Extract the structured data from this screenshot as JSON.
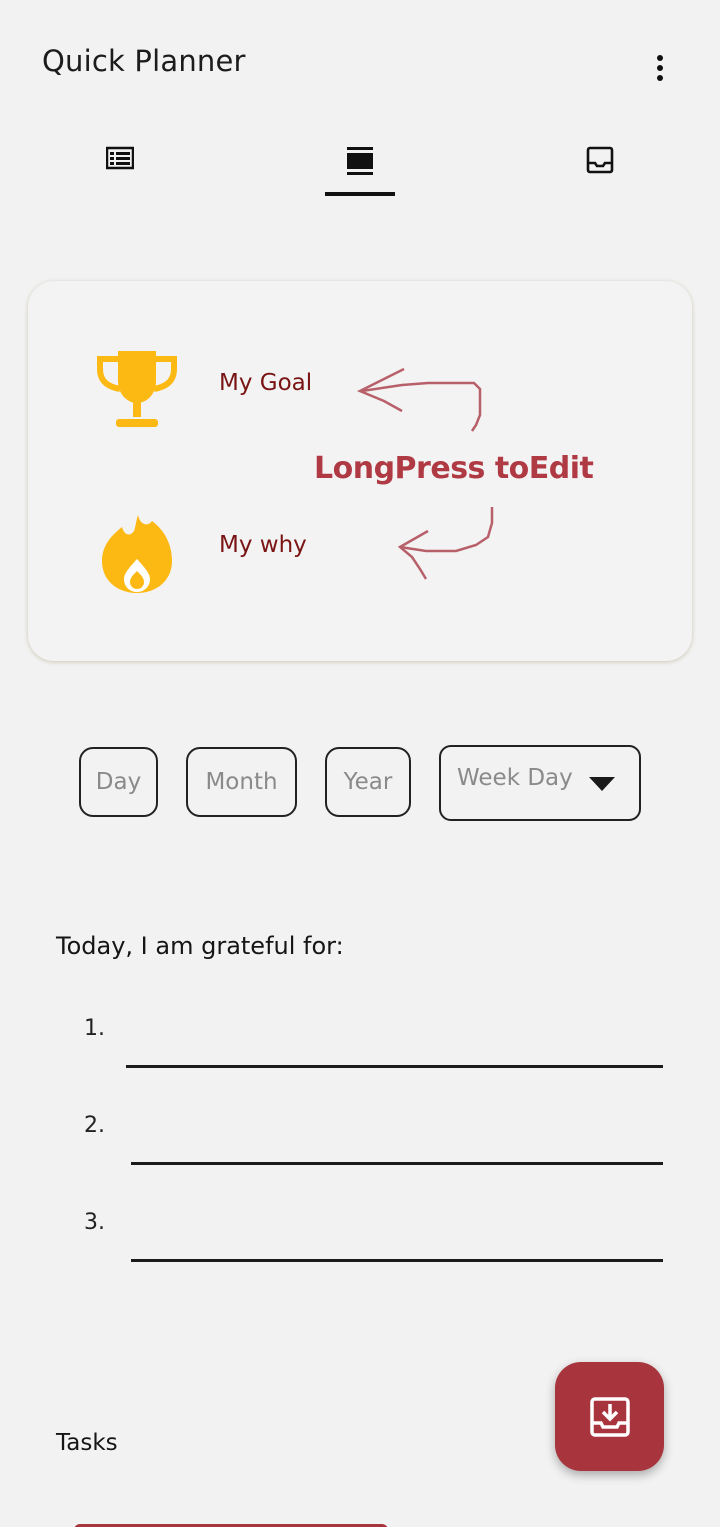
{
  "app": {
    "title": "Quick Planner",
    "menu_icon": "more-vert-icon"
  },
  "tabs": [
    {
      "name": "list",
      "icon": "list-icon",
      "selected": false
    },
    {
      "name": "card",
      "icon": "card-view-icon",
      "selected": true
    },
    {
      "name": "inbox",
      "icon": "inbox-icon",
      "selected": false
    }
  ],
  "goal_card": {
    "goal_label": "My Goal",
    "why_label": "My why",
    "hint": "LongPress toEdit",
    "goal_icon": "trophy-icon",
    "why_icon": "flame-icon"
  },
  "date": {
    "day_placeholder": "Day",
    "month_placeholder": "Month",
    "year_placeholder": "Year",
    "weekday_placeholder": "Week Day"
  },
  "gratitude": {
    "heading": "Today, I am grateful for:",
    "items": [
      "1.",
      "2.",
      "3."
    ]
  },
  "tasks": {
    "heading": "Tasks"
  },
  "fab": {
    "icon": "save-to-inbox-icon"
  },
  "colors": {
    "background": "#f2f2f2",
    "accent": "#a8353d",
    "goal_text": "#7a1414",
    "icon_gold": "#fdb913",
    "hint_text": "#b03a44"
  }
}
